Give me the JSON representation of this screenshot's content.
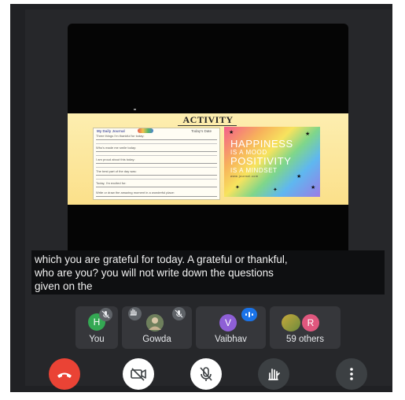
{
  "slide": {
    "title": "ACTIVITY",
    "journal": {
      "heading": "My Daily Journal",
      "date_label": "Today's Date",
      "prompts": [
        "Three things I'm thankful for today:",
        "Who's made me smile today:",
        "I am proud about this today:",
        "The best part of the day was:",
        "Today, I'm excited for:",
        "Write or draw the amazing moment in a wonderful place:"
      ]
    },
    "poster": {
      "line1": "HAPPINESS",
      "line2": "IS A MOOD",
      "line3": "POSITIVITY",
      "line4": "IS A MINDSET",
      "line5": "www.journal.com"
    }
  },
  "caption": {
    "line1": "which you are grateful for today. A grateful or thankful,",
    "line2": "who are you? you will not write down the questions",
    "line3": "given on the"
  },
  "participants": [
    {
      "name": "You",
      "initial": "H",
      "color": "#34a853"
    },
    {
      "name": "Gowda",
      "initial": "",
      "color": "#7a8a6a"
    },
    {
      "name": "Vaibhav",
      "initial": "V",
      "color": "#8e5fd6"
    },
    {
      "name": "59 others",
      "initial": "R",
      "color": "#e0577e"
    }
  ],
  "colors": {
    "end_call": "#ea4335",
    "control_bg": "#ffffff",
    "hand_control_bg": "#3c4043",
    "speaking_badge": "#1a73e8"
  }
}
